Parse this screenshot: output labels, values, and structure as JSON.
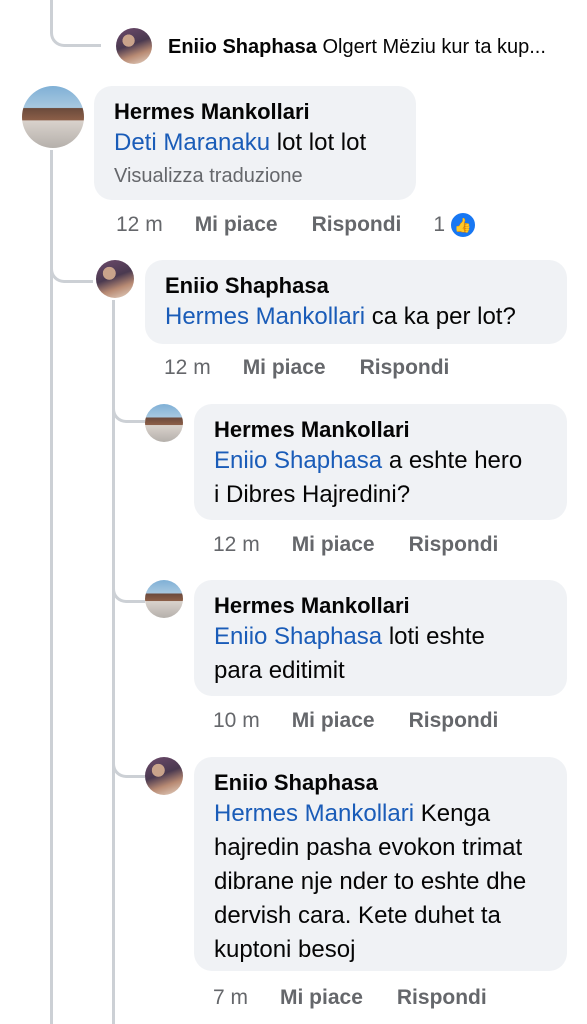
{
  "top_reply": {
    "author": "Eniio Shaphasa",
    "preview": "Olgert Mëziu kur ta kup..."
  },
  "comments": [
    {
      "author": "Hermes Mankollari",
      "mention": "Deti Maranaku",
      "text": "lot lot lot",
      "translate": "Visualizza traduzione",
      "time": "12 m",
      "like": "Mi piace",
      "reply": "Rispondi",
      "likes": "1"
    },
    {
      "author": "Eniio Shaphasa",
      "mention": "Hermes Mankollari",
      "text": "ca ka per lot?",
      "time": "12 m",
      "like": "Mi piace",
      "reply": "Rispondi"
    },
    {
      "author": "Hermes Mankollari",
      "mention": "Eniio Shaphasa",
      "text_line1": "a eshte hero",
      "text_line2": "i Dibres Hajredini?",
      "time": "12 m",
      "like": "Mi piace",
      "reply": "Rispondi"
    },
    {
      "author": "Hermes Mankollari",
      "mention": "Eniio Shaphasa",
      "text_line1": "loti eshte",
      "text_line2": "para editimit",
      "time": "10 m",
      "like": "Mi piace",
      "reply": "Rispondi"
    },
    {
      "author": "Eniio Shaphasa",
      "mention": "Hermes Mankollari",
      "text_line1": "Kenga",
      "text_line2": "hajredin pasha evokon trimat",
      "text_line3": "dibrane nje nder to eshte dhe",
      "text_line4": "dervish cara. Kete duhet ta",
      "text_line5": "kuptoni besoj",
      "time": "7 m",
      "like": "Mi piace",
      "reply": "Rispondi"
    }
  ],
  "icons": {
    "like_badge": "thumbs-up-icon"
  },
  "colors": {
    "mention": "#1a5cb8",
    "bubble": "#f0f2f5",
    "meta": "#65676b",
    "like_badge": "#1877f2"
  }
}
